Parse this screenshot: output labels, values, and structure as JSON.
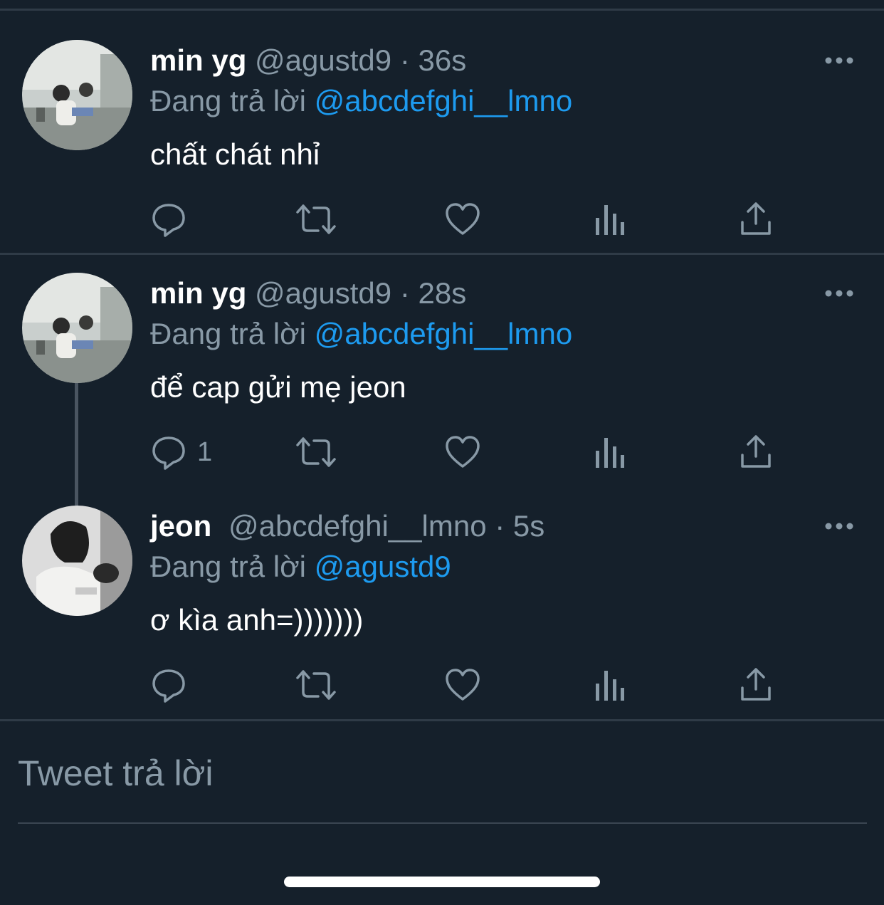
{
  "tweets": [
    {
      "name": "min yg",
      "handle": "@agustd9",
      "dot": "·",
      "time": "36s",
      "reply_prefix": "Đang trả lời",
      "reply_to": "@abcdefghi__lmno",
      "text": "chất chát nhỉ",
      "reply_count": ""
    },
    {
      "name": "min yg",
      "handle": "@agustd9",
      "dot": "·",
      "time": "28s",
      "reply_prefix": "Đang trả lời",
      "reply_to": "@abcdefghi__lmno",
      "text": "để cap gửi mẹ jeon",
      "reply_count": "1"
    },
    {
      "name": "jeon",
      "handle": "@abcdefghi__lmno",
      "dot": "·",
      "time": "5s",
      "reply_prefix": "Đang trả lời",
      "reply_to": "@agustd9",
      "text": "ơ kìa anh=)))))))",
      "reply_count": ""
    }
  ],
  "icons": [
    "reply-icon",
    "retweet-icon",
    "like-icon",
    "analytics-icon",
    "share-icon",
    "more-icon"
  ],
  "composer": {
    "placeholder": "Tweet trả lời"
  },
  "colors": {
    "background": "#15202b",
    "accent": "#1d9bf0",
    "muted": "#8899a6"
  }
}
